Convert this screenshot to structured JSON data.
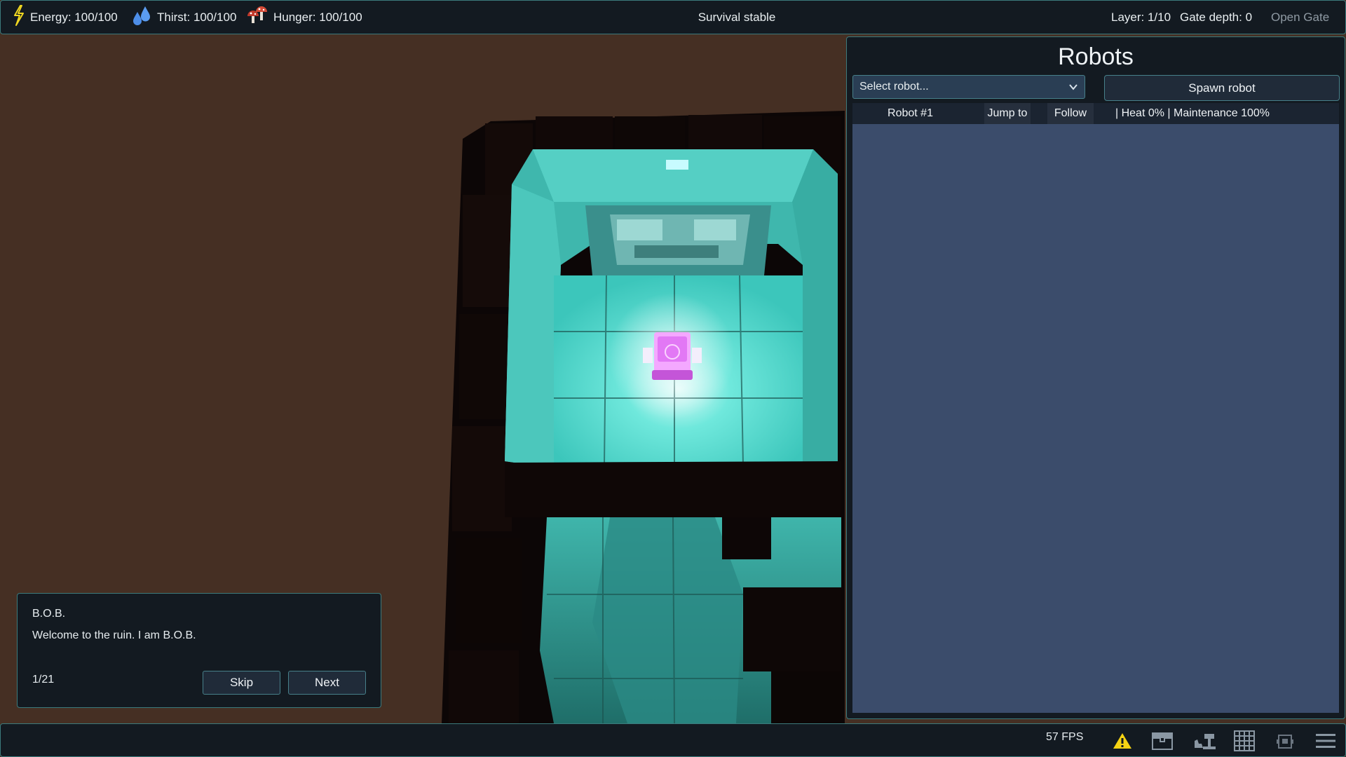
{
  "top_bar": {
    "energy": "Energy: 100/100",
    "thirst": "Thirst: 100/100",
    "hunger": "Hunger: 100/100",
    "survival_status": "Survival stable",
    "layer": "Layer: 1/10",
    "gate_depth": "Gate depth: 0",
    "open_gate": "Open Gate",
    "icons": {
      "energy": "lightning-icon",
      "thirst": "water-drops-icon",
      "hunger": "mushrooms-icon"
    }
  },
  "robots_panel": {
    "title": "Robots",
    "select_placeholder": "Select robot...",
    "spawn_label": "Spawn robot",
    "robots": [
      {
        "name": "Robot #1",
        "jump_label": "Jump to",
        "follow_label": "Follow",
        "stats": "| Heat 0% | Maintenance 100%"
      }
    ]
  },
  "dialog": {
    "speaker": "B.O.B.",
    "message": "Welcome to the ruin. I am B.O.B.",
    "progress": "1/21",
    "skip_label": "Skip",
    "next_label": "Next"
  },
  "bottom_bar": {
    "fps": "57 FPS",
    "icons": [
      "warning-icon",
      "inventory-chest-icon",
      "crafting-anvil-icon",
      "grid-icon",
      "robot-icon",
      "menu-icon"
    ]
  },
  "colors": {
    "panel_bg": "#131a21",
    "panel_border": "#3c7a7c",
    "list_bg": "#3b4c6b",
    "ground": "#452f23",
    "room_glow": "#4fe0d4",
    "robot": "#e070f0",
    "warning": "#f5d313"
  }
}
